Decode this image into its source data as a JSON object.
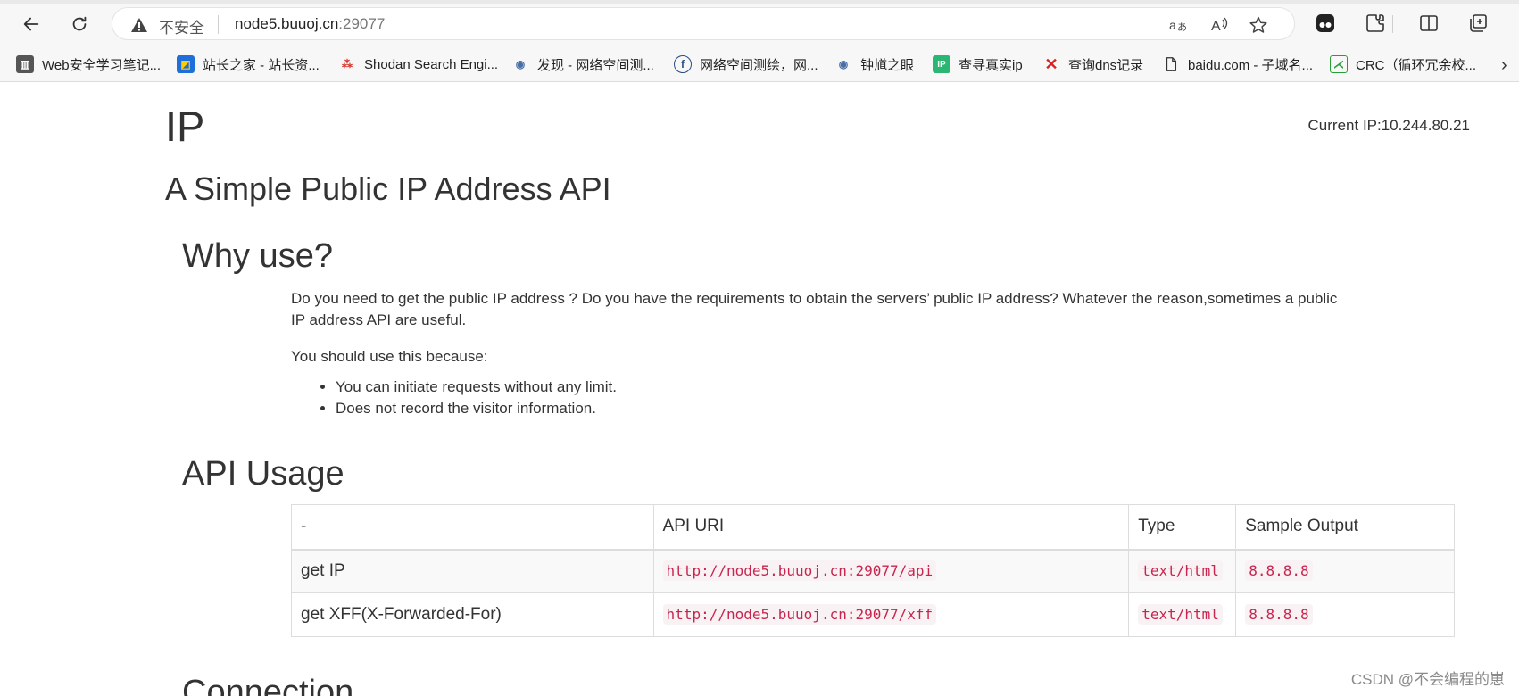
{
  "browser": {
    "address_bar": {
      "security_label": "不安全",
      "url_host": "node5.buuoj.cn",
      "url_port": ":29077"
    },
    "bookmarks": [
      {
        "label": "Web安全学习笔记...",
        "icon": "book-icon"
      },
      {
        "label": "站长之家 - 站长资...",
        "icon": "chinaz-icon"
      },
      {
        "label": "Shodan Search Engi...",
        "icon": "shodan-icon"
      },
      {
        "label": "发现 - 网络空间测...",
        "icon": "eye-icon"
      },
      {
        "label": "网络空间测绘，网...",
        "icon": "fofa-icon"
      },
      {
        "label": "钟馗之眼",
        "icon": "eye-icon"
      },
      {
        "label": "查寻真实ip",
        "icon": "ip-icon"
      },
      {
        "label": "查询dns记录",
        "icon": "x-icon"
      },
      {
        "label": "baidu.com - 子域名...",
        "icon": "page-icon"
      },
      {
        "label": "CRC（循环冗余校...",
        "icon": "crc-icon"
      }
    ]
  },
  "page": {
    "title": "IP",
    "current_ip": "Current IP:10.244.80.21",
    "subtitle": "A Simple Public IP Address API",
    "why_heading": "Why use?",
    "why_paragraph": "Do you need to get the public IP address ? Do you have the requirements to obtain the servers’ public IP address? Whatever the reason,sometimes a public IP address API are useful.",
    "because_text": "You should use this because:",
    "reasons": [
      "You can initiate requests without any limit.",
      "Does not record the visitor information."
    ],
    "api_heading": "API Usage",
    "table": {
      "headers": [
        "-",
        "API URI",
        "Type",
        "Sample Output"
      ],
      "rows": [
        {
          "name": "get IP",
          "uri": "http://node5.buuoj.cn:29077/api",
          "type": "text/html",
          "output": "8.8.8.8"
        },
        {
          "name": "get XFF(X-Forwarded-For)",
          "uri": "http://node5.buuoj.cn:29077/xff",
          "type": "text/html",
          "output": "8.8.8.8"
        }
      ]
    },
    "connection_heading": "Connection"
  },
  "watermark": "CSDN @不会编程的崽"
}
